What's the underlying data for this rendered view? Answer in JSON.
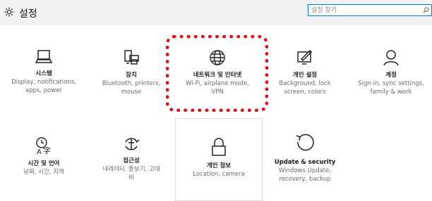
{
  "window": {
    "title": "설정"
  },
  "search": {
    "placeholder": "설정 찾기"
  },
  "tiles": [
    {
      "title": "시스템",
      "desc_lines": [
        "Display, notifications,",
        "apps, power"
      ]
    },
    {
      "title": "장치",
      "desc_lines": [
        "Bluetooth, printers,",
        "mouse"
      ]
    },
    {
      "title": "네트워크 및 인터넷",
      "desc_lines": [
        "Wi-Fi, airplane mode,",
        "VPN"
      ]
    },
    {
      "title": "개인 설정",
      "desc_lines": [
        "Background, lock",
        "screen, colors"
      ]
    },
    {
      "title": "계정",
      "desc_lines": [
        "Sign-in, sync settings,",
        "family & work"
      ]
    },
    {
      "title": "시간 및 언어",
      "desc_lines": [
        "날짜, 시간, 지역"
      ]
    },
    {
      "title": "접근성",
      "desc_lines": [
        "내레이터, 돋보기, 고대",
        "비"
      ]
    },
    {
      "title": "개인 정보",
      "desc_lines": [
        "Location, camera"
      ]
    },
    {
      "title": "Update & security",
      "desc_lines": [
        "Windows Update,",
        "recovery, backup"
      ]
    }
  ],
  "colors": {
    "accent": "#0078d7",
    "highlight": "#e01010",
    "titlebar": "#f2f2f2"
  }
}
